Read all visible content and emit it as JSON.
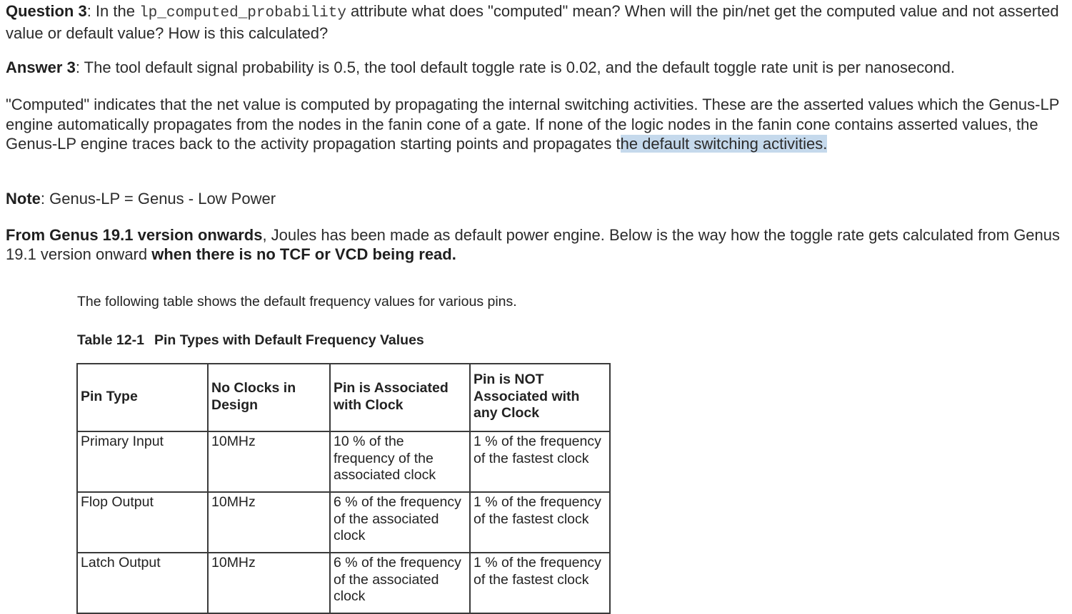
{
  "question": {
    "label": "Question 3",
    "text_before": ": In the ",
    "code": "lp_computed_probability",
    "text_after": " attribute what does \"computed\" mean? When will the pin/net get the computed value and not asserted value or default value? How is this calculated?"
  },
  "answer": {
    "label": "Answer 3",
    "text": ": The tool default signal probability is 0.5, the tool default toggle rate is 0.02, and the default toggle rate unit is per nanosecond."
  },
  "computed_paragraph": {
    "text": "\"Computed\" indicates that the net value is computed by propagating the internal switching activities. These are the asserted values which the Genus-LP engine automatically propagates from the nodes in the fanin cone of a gate. If none of the logic nodes in the fanin cone contains asserted values, the Genus-LP engine traces back to the activity propagation starting points and propagates t",
    "highlighted": "he default switching activities."
  },
  "note": {
    "label": "Note",
    "text": ": Genus-LP = Genus - Low Power"
  },
  "from_paragraph": {
    "bold_lead": "From Genus 19.1 version onwards",
    "text": ", Joules has been made as default power engine. Below is the way how the toggle rate gets calculated from Genus 19.1 version onward ",
    "bold_tail": "when there is no TCF or VCD being read."
  },
  "doc_excerpt": {
    "intro": "The following table shows the default frequency values for various pins.",
    "table_number": "Table 12-1",
    "table_title": "Pin Types with Default Frequency Values",
    "headers": [
      "Pin Type",
      "No Clocks in Design",
      "Pin is Associated with Clock",
      "Pin is NOT Associated with any Clock"
    ],
    "rows": [
      [
        "Primary Input",
        "10MHz",
        "10 % of the frequency of the associated clock",
        "1 % of the frequency of the fastest clock"
      ],
      [
        "Flop Output",
        "10MHz",
        "6 % of the frequency of the associated clock",
        "1 % of the frequency of the fastest clock"
      ],
      [
        "Latch Output",
        "10MHz",
        "6 % of the frequency of the associated clock",
        "1 % of the frequency of the fastest clock"
      ]
    ]
  },
  "colors": {
    "highlight": "#c5d9ec",
    "text": "#2b2b2b",
    "table_border": "#3a3a3a"
  }
}
